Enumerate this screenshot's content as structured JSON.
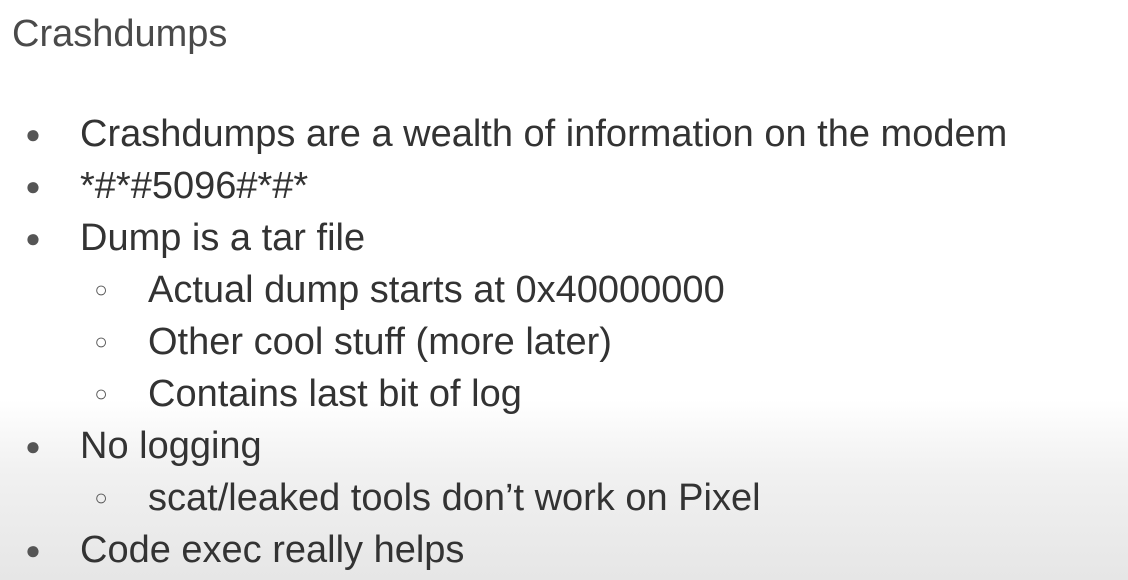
{
  "slide": {
    "title": "Crashdumps",
    "bullet_glyph": "●",
    "sub_bullet_glyph": "○",
    "items": [
      {
        "level": 1,
        "text": "Crashdumps are a wealth of information on the modem"
      },
      {
        "level": 1,
        "text": "*#*#5096#*#*"
      },
      {
        "level": 1,
        "text": "Dump is a tar file"
      },
      {
        "level": 2,
        "text": "Actual dump starts at 0x40000000"
      },
      {
        "level": 2,
        "text": "Other cool stuff (more later)"
      },
      {
        "level": 2,
        "text": "Contains last bit of log"
      },
      {
        "level": 1,
        "text": "No logging"
      },
      {
        "level": 2,
        "text": "scat/leaked tools don’t work on Pixel"
      },
      {
        "level": 1,
        "text": "Code exec really helps"
      }
    ]
  }
}
